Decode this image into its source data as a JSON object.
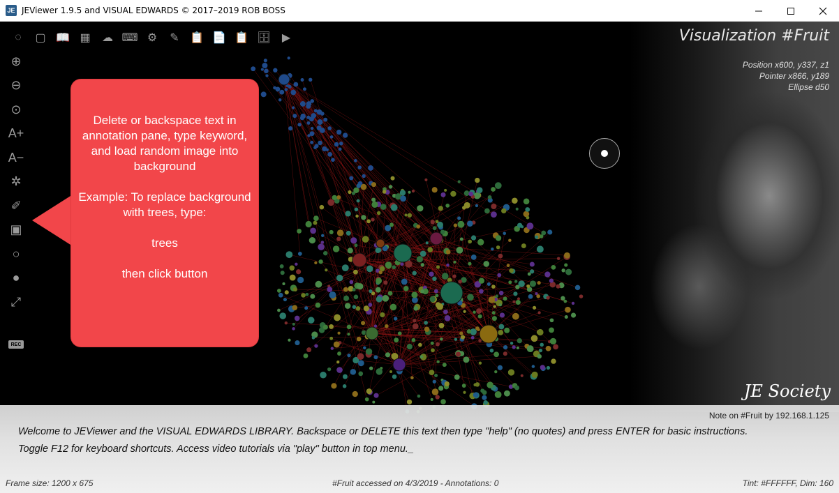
{
  "window": {
    "title": "JEViewer 1.9.5 and VISUAL EDWARDS © 2017–2019 ROB BOSS",
    "app_icon_text": "JE",
    "controls": [
      "minimize",
      "maximize",
      "close"
    ]
  },
  "toolbar_top": [
    {
      "name": "loading-icon",
      "glyph": "◌"
    },
    {
      "name": "note-icon",
      "glyph": "▢"
    },
    {
      "name": "book-icon",
      "glyph": "📖"
    },
    {
      "name": "table-icon",
      "glyph": "▦"
    },
    {
      "name": "cloud-download-icon",
      "glyph": "☁"
    },
    {
      "name": "terminal-icon",
      "glyph": "⌨"
    },
    {
      "name": "gear-icon",
      "glyph": "⚙"
    },
    {
      "name": "pen-icon",
      "glyph": "✎"
    },
    {
      "name": "clipboard-add-icon",
      "glyph": "📋"
    },
    {
      "name": "clipboard-copy-icon",
      "glyph": "📄"
    },
    {
      "name": "clipboard-icon",
      "glyph": "📋"
    },
    {
      "name": "archive-icon",
      "glyph": "🗄"
    },
    {
      "name": "play-icon",
      "glyph": "▶"
    }
  ],
  "toolbar_left": [
    {
      "name": "zoom-in-icon",
      "glyph": "⊕"
    },
    {
      "name": "zoom-out-icon",
      "glyph": "⊖"
    },
    {
      "name": "zoom-reset-icon",
      "glyph": "⊙"
    },
    {
      "name": "font-increase-icon",
      "glyph": "A+"
    },
    {
      "name": "font-decrease-icon",
      "glyph": "A−"
    },
    {
      "name": "network-icon",
      "glyph": "✲"
    },
    {
      "name": "eyedropper-icon",
      "glyph": "✐"
    },
    {
      "name": "image-icon",
      "glyph": "▣"
    },
    {
      "name": "circle-outline-icon",
      "glyph": "○"
    },
    {
      "name": "circle-filled-icon",
      "glyph": "●"
    },
    {
      "name": "expand-icon",
      "glyph": "⤢"
    }
  ],
  "rec_label": "REC",
  "viz_title": "Visualization #Fruit",
  "readouts": {
    "position": "Position x600, y337, z1",
    "pointer": "Pointer x866, y189",
    "ellipse": "Ellipse d50"
  },
  "callout": {
    "text": "Delete or backspace text in annotation pane, type keyword, and load random image into background\n\nExample: To replace background with trees, type:\n\ntrees\n\nthen click button"
  },
  "society_logo": "JE Society",
  "annotation": {
    "note_by": "Note on #Fruit by 192.168.1.125",
    "text": "Welcome to JEViewer and the VISUAL EDWARDS LIBRARY. Backspace or DELETE this text then type \"help\" (no quotes) and press ENTER for basic instructions. Toggle F12 for keyboard shortcuts. Access video tutorials via \"play\" button in top menu._"
  },
  "status": {
    "frame_size": "Frame size: 1200 x 675",
    "accessed": "#Fruit accessed on 4/3/2019 - Annotations: 0",
    "tint": "Tint: #FFFFFF, Dim: 160"
  },
  "colors": {
    "callout": "#f2464a",
    "edge": "#b01818",
    "node_palette": [
      "#2d6a3a",
      "#3f7f3a",
      "#6a7a20",
      "#8a6a1a",
      "#5a2f8a",
      "#1f5a8a",
      "#7a2a2a",
      "#2a7a6a",
      "#8a8a2a",
      "#4a8a4a"
    ]
  }
}
